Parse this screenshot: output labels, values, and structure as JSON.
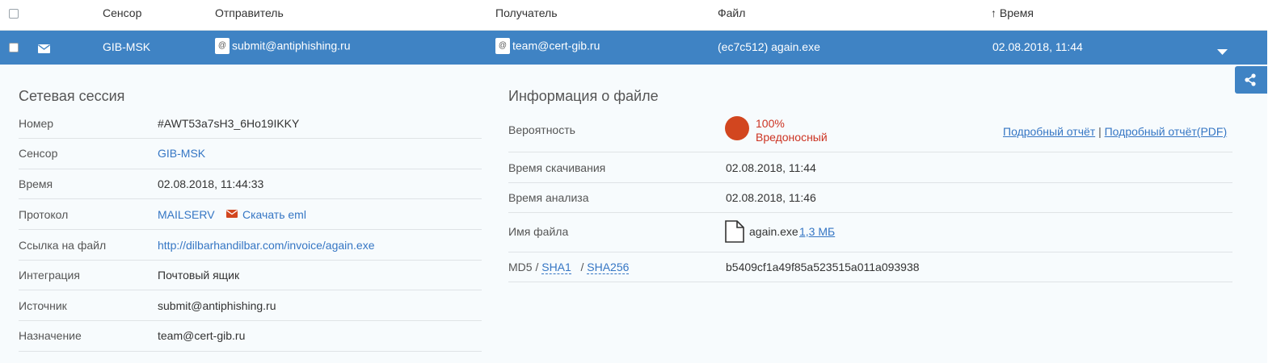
{
  "header": {
    "col_sensor": "Сенсор",
    "col_sender": "Отправитель",
    "col_recipient": "Получатель",
    "col_file": "Файл",
    "sort_arrow": "↑",
    "col_time": "Время"
  },
  "row": {
    "sensor": "GIB-MSK",
    "sender": "submit@antiphishing.ru",
    "recipient": "team@cert-gib.ru",
    "file": "(ec7c512) again.exe",
    "time": "02.08.2018, 11:44",
    "at_glyph": "@",
    "icon": "envelope-icon",
    "expand_icon": "caret-down-icon"
  },
  "session": {
    "title": "Сетевая сессия",
    "number_label": "Номер",
    "number_value": "#AWT53a7sH3_6Ho19IKKY",
    "sensor_label": "Сенсор",
    "sensor_value": "GIB-MSK",
    "time_label": "Время",
    "time_value": "02.08.2018, 11:44:33",
    "protocol_label": "Протокол",
    "protocol_value": "MAILSERV",
    "download_eml": "Скачать eml",
    "file_link_label": "Ссылка на файл",
    "file_link_value": "http://dilbarhandilbar.com/invoice/again.exe",
    "integration_label": "Интеграция",
    "integration_value": "Почтовый ящик",
    "source_label": "Источник",
    "source_value": "submit@antiphishing.ru",
    "destination_label": "Назначение",
    "destination_value": "team@cert-gib.ru"
  },
  "file_info": {
    "title": "Информация о файле",
    "probability_label": "Вероятность",
    "probability_percent": "100%",
    "verdict": "Вредоносный",
    "report_link": "Подробный отчёт",
    "link_separator": "|",
    "report_pdf_link": "Подробный отчёт(PDF)",
    "download_time_label": "Время скачивания",
    "download_time_value": "02.08.2018, 11:44",
    "analysis_time_label": "Время анализа",
    "analysis_time_value": "02.08.2018, 11:46",
    "file_name_label": "Имя файла",
    "file_name_value": "again.exe",
    "file_size": "1,3 МБ",
    "md5_label": "MD5",
    "slash1": "/",
    "sha1_link": "SHA1",
    "slash2": "/",
    "sha256_link": "SHA256",
    "hash_value": "b5409cf1a49f85a523515a011a093938"
  },
  "colors": {
    "accent": "#3f83c4",
    "malicious": "#d2461f",
    "link": "#3576c4"
  }
}
